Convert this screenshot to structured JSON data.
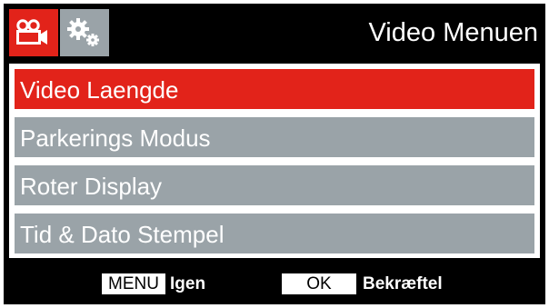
{
  "header": {
    "title": "Video Menuen",
    "tabs": [
      {
        "icon": "video-camera-icon",
        "active": true
      },
      {
        "icon": "settings-gears-icon",
        "active": false
      }
    ]
  },
  "menu": {
    "items": [
      {
        "label": "Video Laengde",
        "selected": true
      },
      {
        "label": "Parkerings Modus",
        "selected": false
      },
      {
        "label": "Roter Display",
        "selected": false
      },
      {
        "label": "Tid & Dato Stempel",
        "selected": false
      }
    ]
  },
  "footer": {
    "menu_key": "MENU",
    "menu_hint": "Igen",
    "ok_key": "OK",
    "ok_hint": "Bekræftel"
  },
  "colors": {
    "accent": "#e2231a",
    "item": "#9aa3a8",
    "background": "#000000"
  }
}
